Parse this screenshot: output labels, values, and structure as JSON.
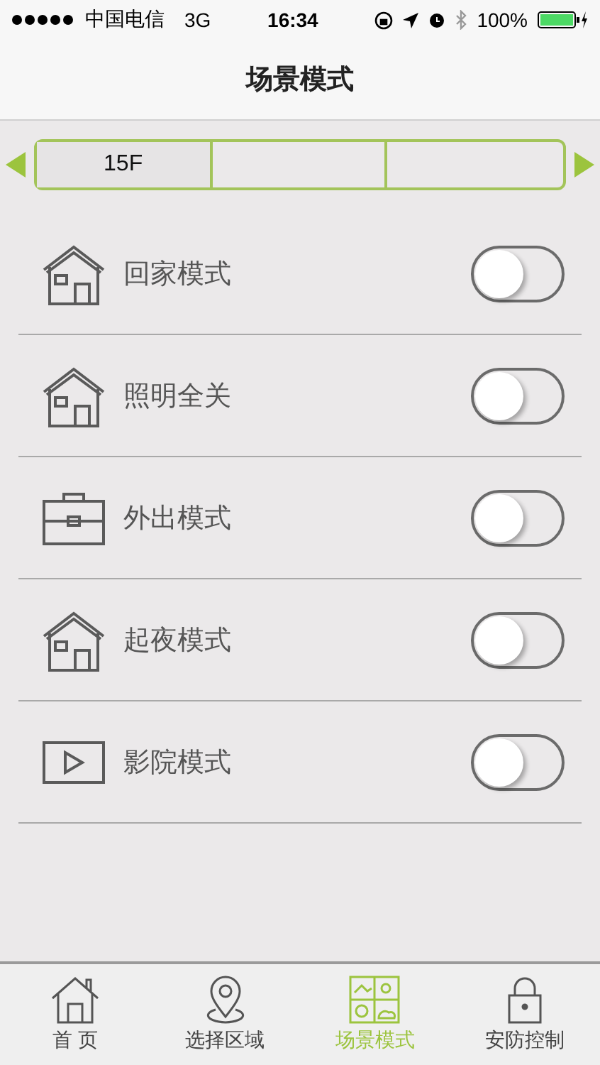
{
  "status_bar": {
    "carrier": "中国电信",
    "network": "3G",
    "time": "16:34",
    "battery": "100%"
  },
  "nav_bar": {
    "title": "场景模式"
  },
  "floor_selector": {
    "floors": [
      {
        "label": "15F",
        "selected": true
      }
    ]
  },
  "scenes": [
    {
      "kind": "house",
      "label": "回家模式",
      "on": false
    },
    {
      "kind": "house",
      "label": "照明全关",
      "on": false
    },
    {
      "kind": "briefcase",
      "label": "外出模式",
      "on": false
    },
    {
      "kind": "house",
      "label": "起夜模式",
      "on": false
    },
    {
      "kind": "video",
      "label": "影院模式",
      "on": false
    }
  ],
  "tab_bar": [
    {
      "kind": "home",
      "label": "首 页",
      "selected": false
    },
    {
      "kind": "pin",
      "label": "选择区域",
      "selected": false
    },
    {
      "kind": "scenes",
      "label": "场景模式",
      "selected": true
    },
    {
      "kind": "lock",
      "label": "安防控制",
      "selected": false
    }
  ]
}
